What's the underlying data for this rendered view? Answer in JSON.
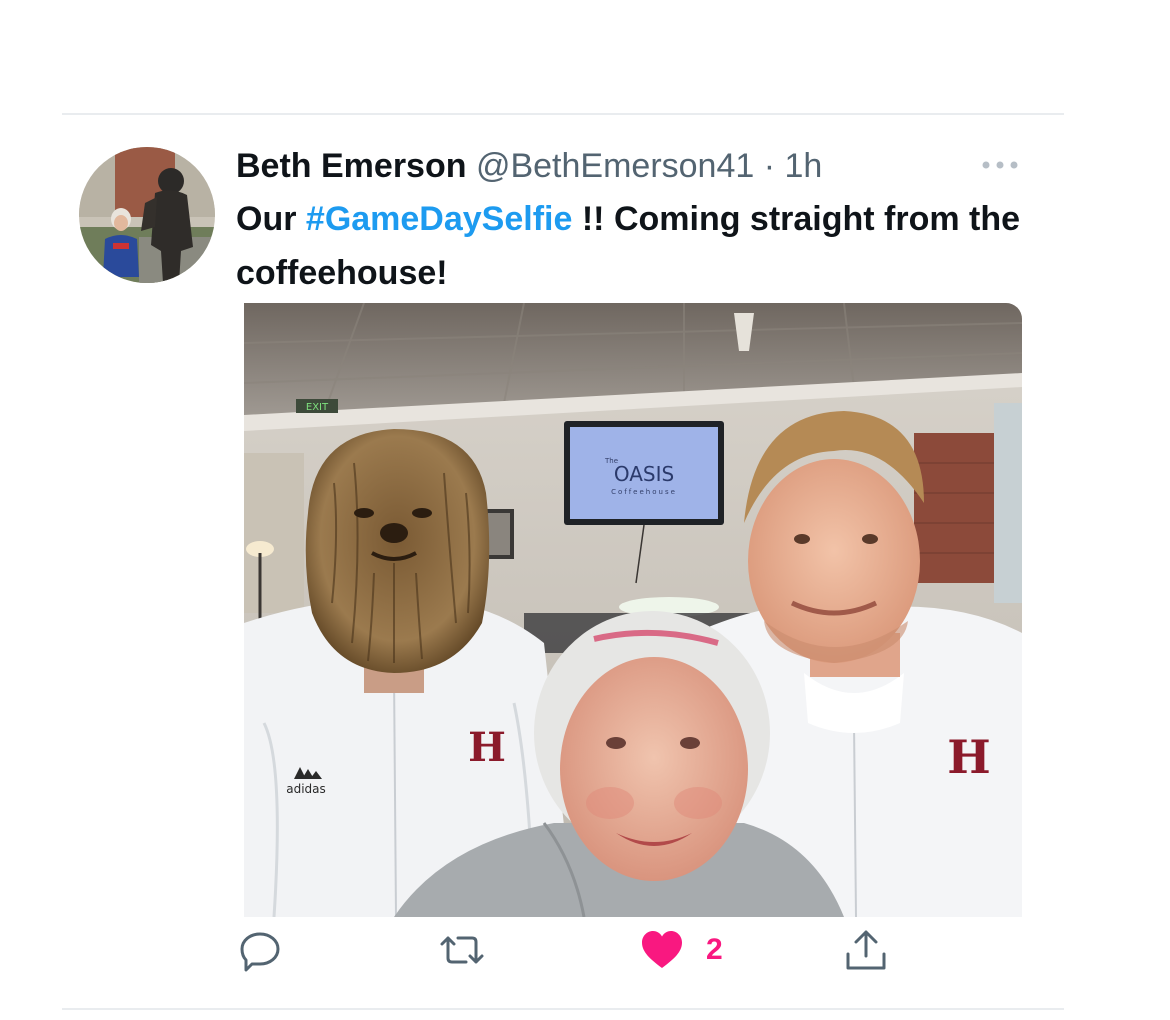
{
  "tweet": {
    "author_name": "Beth Emerson",
    "handle": "@BethEmerson41",
    "separator": "·",
    "time": "1h",
    "text_before": "Our ",
    "hashtag": "#GameDaySelfie",
    "text_after": " !! Coming straight from the coffeehouse!"
  },
  "media": {
    "tv_brand_small": "The",
    "tv_brand": "OASIS",
    "tv_brand_sub": "Coffeehouse",
    "exit_sign": "EXIT",
    "jacket_logo": "H",
    "jacket_brand": "adidas"
  },
  "actions": {
    "like_count": "2",
    "liked": true
  },
  "icons": {
    "more": "more-horizontal-icon",
    "reply": "reply-icon",
    "retweet": "retweet-icon",
    "like": "heart-icon",
    "share": "share-icon"
  },
  "colors": {
    "hashtag": "#1d9bf0",
    "like": "#f91880",
    "secondary_text": "#536471",
    "icon_gray": "#536471"
  }
}
